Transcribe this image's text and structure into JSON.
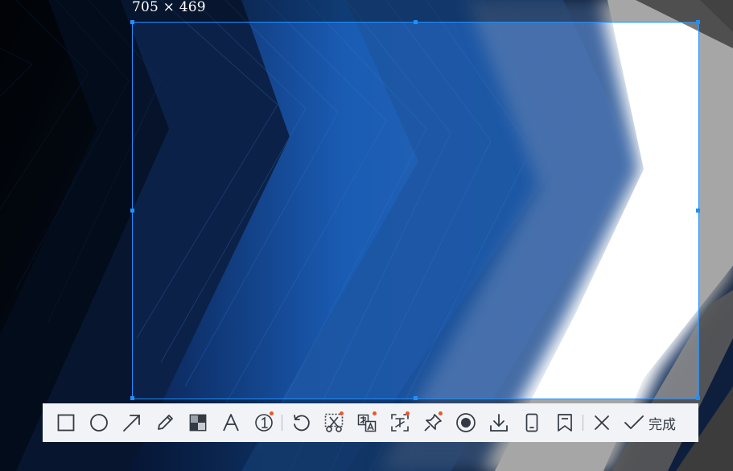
{
  "selection": {
    "size_label": "705 × 469"
  },
  "toolbar": {
    "tools": [
      {
        "icon": "rectangle-icon",
        "dot": false
      },
      {
        "icon": "ellipse-icon",
        "dot": false
      },
      {
        "icon": "arrow-icon",
        "dot": false
      },
      {
        "icon": "pencil-icon",
        "dot": false
      },
      {
        "icon": "mosaic-icon",
        "dot": false
      },
      {
        "icon": "text-icon",
        "dot": false
      },
      {
        "icon": "number-marker-icon",
        "dot": true
      },
      {
        "icon": "undo-icon",
        "dot": false
      },
      {
        "icon": "cut-icon",
        "dot": true
      },
      {
        "icon": "translate-icon",
        "dot": true
      },
      {
        "icon": "ocr-text-icon",
        "dot": true
      },
      {
        "icon": "pin-icon",
        "dot": true
      },
      {
        "icon": "record-icon",
        "dot": false
      },
      {
        "icon": "download-icon",
        "dot": false
      },
      {
        "icon": "long-screenshot-icon",
        "dot": false
      },
      {
        "icon": "bookmark-icon",
        "dot": false
      },
      {
        "icon": "close-icon",
        "dot": false
      }
    ],
    "done_label": "完成",
    "icon_color": "#333a44",
    "dot_color": "#e8572b",
    "background": "#f2f3f6"
  },
  "colors": {
    "selection_border": "#1e90ff"
  }
}
